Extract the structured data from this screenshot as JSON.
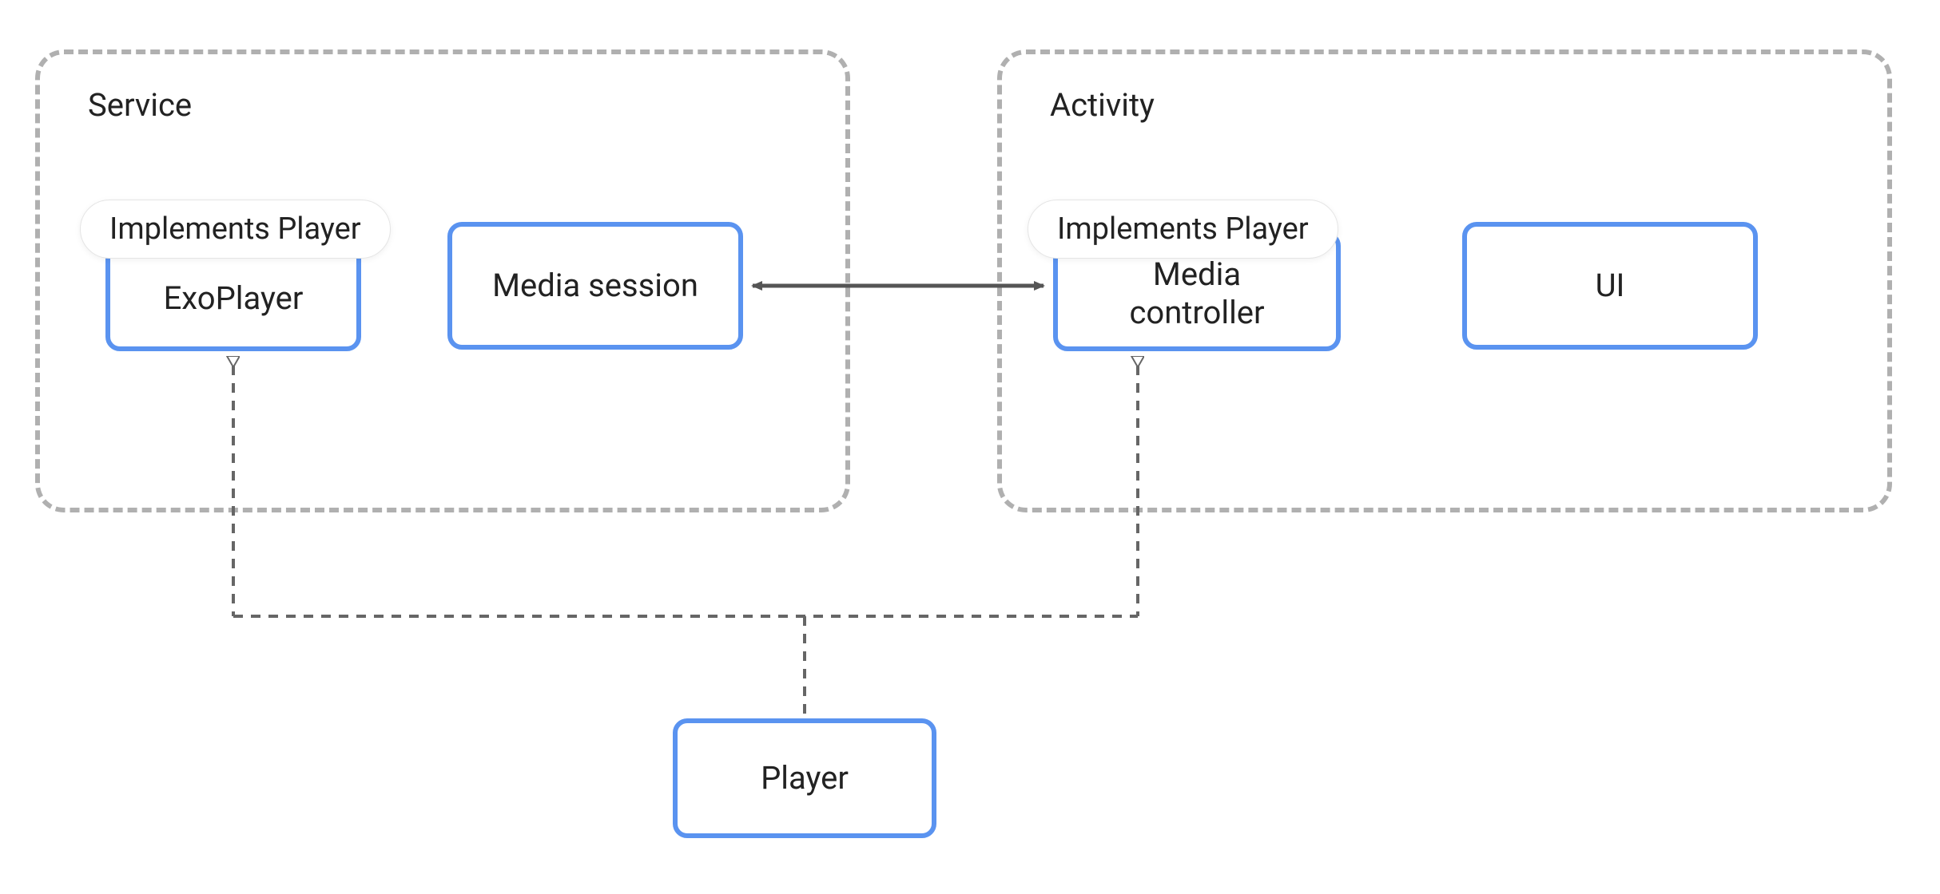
{
  "diagram": {
    "containers": {
      "service": {
        "label": "Service"
      },
      "activity": {
        "label": "Activity"
      }
    },
    "nodes": {
      "exoplayer": {
        "label": "ExoPlayer",
        "badge": "Implements Player"
      },
      "media_session": {
        "label": "Media session"
      },
      "media_controller": {
        "label_line1": "Media",
        "label_line2": "controller",
        "badge": "Implements Player"
      },
      "ui": {
        "label": "UI"
      },
      "player": {
        "label": "Player"
      }
    },
    "colors": {
      "node_border": "#5a93f0",
      "container_border": "#b0b0b0",
      "arrow_stroke": "#555555",
      "dashed_stroke": "#666666",
      "background": "#ffffff"
    }
  }
}
